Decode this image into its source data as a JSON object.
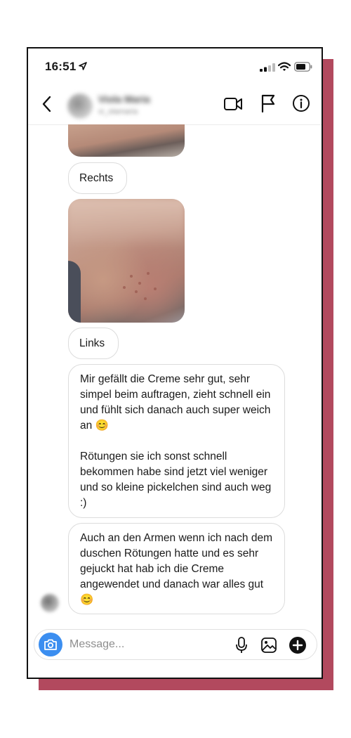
{
  "status_bar": {
    "time": "16:51"
  },
  "header": {
    "contact_name": "Viola Maria",
    "contact_sub": "vi_olamaria"
  },
  "messages": {
    "label_rechts": "Rechts",
    "label_links": "Links",
    "text1": "Mir gefällt die Creme sehr gut, sehr simpel beim auftragen, zieht schnell ein und fühlt sich danach auch super weich an 😊\n\nRötungen sie ich sonst schnell bekommen habe sind jetzt viel weniger und so kleine pickelchen sind auch weg :)",
    "text2": "Auch an den Armen wenn ich nach dem duschen Rötungen hatte und es sehr gejuckt hat hab ich die Creme angewendet und danach war alles gut 😊"
  },
  "composer": {
    "placeholder": "Message..."
  },
  "colors": {
    "accent_frame": "#b2495e",
    "camera_button": "#3b8ef0"
  },
  "icons": [
    "location-arrow-icon",
    "signal-icon",
    "wifi-icon",
    "battery-icon",
    "back-chevron-icon",
    "video-call-icon",
    "flag-icon",
    "info-icon",
    "camera-icon",
    "microphone-icon",
    "gallery-icon",
    "plus-icon"
  ]
}
